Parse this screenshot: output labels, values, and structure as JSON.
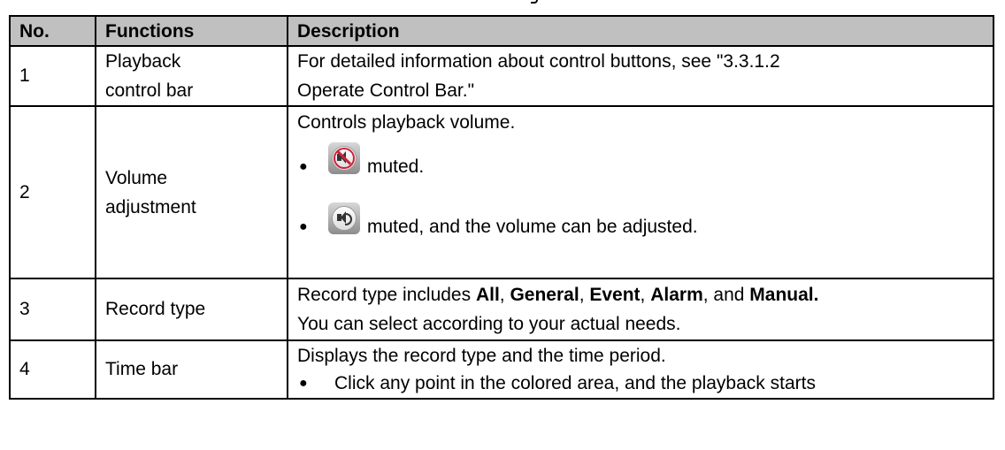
{
  "table": {
    "headers": [
      "No.",
      "Functions",
      "Description"
    ],
    "rows": [
      {
        "no": "1",
        "function_line1": "Playback",
        "function_line2": "control bar",
        "desc_line1": "For detailed information about control buttons, see \"3.3.1.2",
        "desc_line2": "Operate Control Bar.\""
      },
      {
        "no": "2",
        "function_line1": "Volume",
        "function_line2": "adjustment",
        "desc_line1": "Controls playback volume.",
        "bullet1_text": "muted.",
        "bullet2_text": "muted, and the volume can be adjusted.",
        "bullet1_icon": "muted-volume-icon",
        "bullet2_icon": "volume-icon"
      },
      {
        "no": "3",
        "function": "Record type",
        "desc_prefix": "Record type includes ",
        "opt_all": "All",
        "sep1": ", ",
        "opt_general": "General",
        "sep2": ", ",
        "opt_event": "Event",
        "sep3": ", ",
        "opt_alarm": "Alarm",
        "sep4": ", and ",
        "opt_manual": "Manual.",
        "desc_line2": "You can select according to your actual needs."
      },
      {
        "no": "4",
        "function": "Time bar",
        "desc_line1": "Displays the record type and the time period.",
        "bullet_text": "Click any point in the colored area, and the playback starts"
      }
    ]
  },
  "bullet_glyph": "●"
}
